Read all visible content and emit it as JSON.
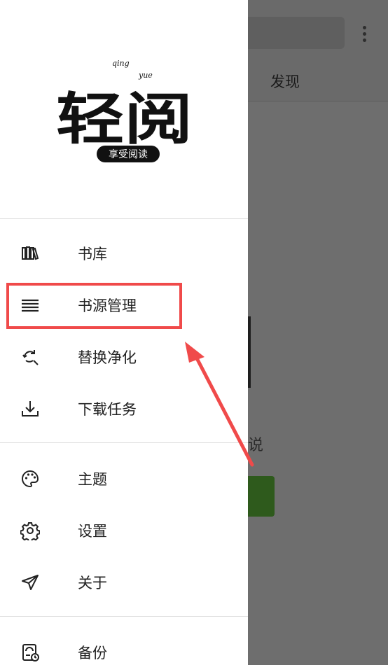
{
  "background": {
    "tab_label": "发现",
    "partial_text": "说"
  },
  "drawer": {
    "logo": {
      "title": "轻阅",
      "pinyin_top": "qing",
      "pinyin_bottom": "yue",
      "subtitle": "享受阅读"
    },
    "items": [
      {
        "label": "书库",
        "icon": "library-icon"
      },
      {
        "label": "书源管理",
        "icon": "list-icon"
      },
      {
        "label": "替换净化",
        "icon": "replace-icon"
      },
      {
        "label": "下载任务",
        "icon": "download-icon"
      },
      {
        "label": "主题",
        "icon": "palette-icon"
      },
      {
        "label": "设置",
        "icon": "gear-icon"
      },
      {
        "label": "关于",
        "icon": "send-icon"
      },
      {
        "label": "备份",
        "icon": "backup-icon"
      }
    ]
  },
  "colors": {
    "highlight": "#f04a4a",
    "accent_green": "#2e5a1c"
  }
}
